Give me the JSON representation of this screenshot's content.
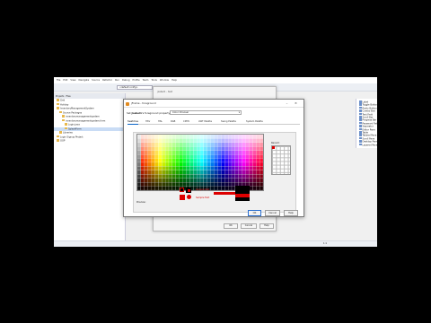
{
  "ide": {
    "menu": [
      "File",
      "Edit",
      "View",
      "Navigate",
      "Source",
      "Refactor",
      "Run",
      "Debug",
      "Profile",
      "Team",
      "Tools",
      "Window",
      "Help"
    ],
    "config_select": "<default config>",
    "panel_tabs": [
      "Projects",
      "Files"
    ],
    "tree": [
      {
        "label": "Grid",
        "indent": 1,
        "selected": false
      },
      {
        "label": "Holiday",
        "indent": 1,
        "selected": false
      },
      {
        "label": "InventoryManagementSystem",
        "indent": 1,
        "selected": false
      },
      {
        "label": "Source Packages",
        "indent": 2,
        "selected": false
      },
      {
        "label": "inventorymanagementsystem",
        "indent": 3,
        "selected": false
      },
      {
        "label": "inventorymanagementsystem.form",
        "indent": 3,
        "selected": false
      },
      {
        "label": "Login.java",
        "indent": 4,
        "selected": false
      },
      {
        "label": "SplashForm",
        "indent": 4,
        "selected": true
      },
      {
        "label": "Libraries",
        "indent": 2,
        "selected": false
      },
      {
        "label": "Login Signup Project",
        "indent": 1,
        "selected": false
      },
      {
        "label": "OOP",
        "indent": 1,
        "selected": false
      }
    ],
    "palette": [
      "Label",
      "Button",
      "Toggle Button",
      "Check Box",
      "Radio Button",
      "Button Group",
      "Combo Box",
      "List",
      "Text Field",
      "Text Area",
      "Scroll Bar",
      "Slider",
      "Progress Bar",
      "Formatted Field",
      "Password Field",
      "Spinner",
      "Separator",
      "Text Pane",
      "Editor Pane",
      "Tree",
      "Table",
      "Panel",
      "Tabbed Pane",
      "Split Pane",
      "Scroll Pane",
      "Tool Bar",
      "Desktop Pane",
      "Internal Frame",
      "Layered Pane"
    ],
    "status": "1:1"
  },
  "back_dialog": {
    "title": "jLabel1 - text",
    "ok": "OK",
    "cancel": "Cancel",
    "help": "Help"
  },
  "color_dialog": {
    "title": "jFrame - foreground",
    "property_prefix": "Set",
    "property_name": "jLabel1",
    "property_suffix": "'s foreground property using:",
    "editor_combo": "Color Chooser",
    "tabs": [
      "Swatches",
      "HSV",
      "HSL",
      "RGB",
      "CMYK",
      "AWT Palette",
      "Swing Palette",
      "System Palette"
    ],
    "active_tab": "Swatches",
    "recent_label": "Recent:",
    "preview_label": "Preview:",
    "preview_text_1": "Sample Text",
    "preview_text_2": "Sample Text",
    "ok": "OK",
    "cancel": "Cancel",
    "help": "Help"
  },
  "colors": {
    "selected": "#dd0000",
    "accent": "#0a64c8"
  }
}
